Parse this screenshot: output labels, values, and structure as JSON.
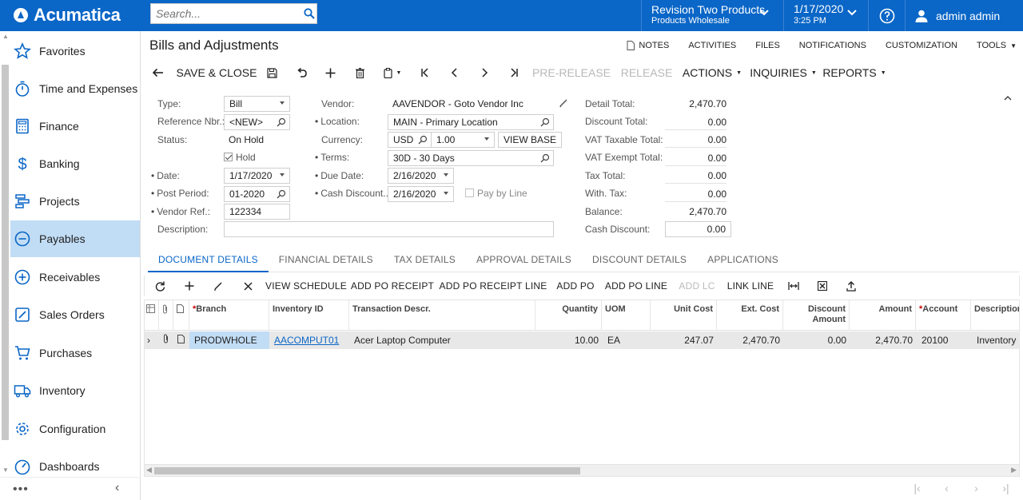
{
  "app": {
    "brand": "Acumatica"
  },
  "topbar": {
    "search_placeholder": "Search...",
    "company_line1": "Revision Two Products",
    "company_line2": "Products Wholesale",
    "date": "1/17/2020",
    "time": "3:25 PM",
    "user": "admin admin"
  },
  "sidebar": {
    "items": [
      {
        "label": "Favorites",
        "icon": "star-icon"
      },
      {
        "label": "Time and Expenses",
        "icon": "stopwatch-icon"
      },
      {
        "label": "Finance",
        "icon": "calculator-icon"
      },
      {
        "label": "Banking",
        "icon": "dollar-icon"
      },
      {
        "label": "Projects",
        "icon": "projects-icon"
      },
      {
        "label": "Payables",
        "icon": "minus-circle-icon",
        "active": true
      },
      {
        "label": "Receivables",
        "icon": "plus-circle-icon"
      },
      {
        "label": "Sales Orders",
        "icon": "edit-square-icon"
      },
      {
        "label": "Purchases",
        "icon": "cart-icon"
      },
      {
        "label": "Inventory",
        "icon": "truck-icon"
      },
      {
        "label": "Configuration",
        "icon": "gear-icon"
      },
      {
        "label": "Dashboards",
        "icon": "gauge-icon"
      }
    ],
    "more": "•••",
    "collapse": "‹"
  },
  "page": {
    "title": "Bills and Adjustments",
    "links": {
      "notes": "NOTES",
      "activities": "ACTIVITIES",
      "files": "FILES",
      "notifications": "NOTIFICATIONS",
      "customization": "CUSTOMIZATION",
      "tools": "TOOLS"
    }
  },
  "toolbar": {
    "save_close": "SAVE & CLOSE",
    "pre_release": "PRE-RELEASE",
    "release": "RELEASE",
    "actions": "ACTIONS",
    "inquiries": "INQUIRIES",
    "reports": "REPORTS"
  },
  "form": {
    "type": {
      "label": "Type:",
      "value": "Bill"
    },
    "ref_nbr": {
      "label": "Reference Nbr.:",
      "value": "<NEW>"
    },
    "status": {
      "label": "Status:",
      "value": "On Hold"
    },
    "hold": {
      "label": "Hold",
      "checked": true
    },
    "date": {
      "label": "Date:",
      "value": "1/17/2020"
    },
    "post_period": {
      "label": "Post Period:",
      "value": "01-2020"
    },
    "vendor_ref": {
      "label": "Vendor Ref.:",
      "value": "122334"
    },
    "description": {
      "label": "Description:",
      "value": ""
    },
    "vendor": {
      "label": "Vendor:",
      "value": "AAVENDOR - Goto Vendor Inc"
    },
    "location": {
      "label": "Location:",
      "value": "MAIN - Primary Location"
    },
    "currency": {
      "label": "Currency:",
      "code": "USD",
      "rate": "1.00",
      "view_base": "VIEW BASE"
    },
    "terms": {
      "label": "Terms:",
      "value": "30D - 30 Days"
    },
    "due_date": {
      "label": "Due Date:",
      "value": "2/16/2020"
    },
    "cash_discount_date": {
      "label": "Cash Discount...",
      "value": "2/16/2020"
    },
    "pay_by_line": {
      "label": "Pay by Line",
      "checked": false
    },
    "totals": [
      {
        "label": "Detail Total:",
        "value": "2,470.70"
      },
      {
        "label": "Discount Total:",
        "value": "0.00"
      },
      {
        "label": "VAT Taxable Total:",
        "value": "0.00"
      },
      {
        "label": "VAT Exempt Total:",
        "value": "0.00"
      },
      {
        "label": "Tax Total:",
        "value": "0.00"
      },
      {
        "label": "With. Tax:",
        "value": "0.00"
      },
      {
        "label": "Balance:",
        "value": "2,470.70"
      },
      {
        "label": "Cash Discount:",
        "value": "0.00"
      }
    ]
  },
  "tabs": [
    "DOCUMENT DETAILS",
    "FINANCIAL DETAILS",
    "TAX DETAILS",
    "APPROVAL DETAILS",
    "DISCOUNT DETAILS",
    "APPLICATIONS"
  ],
  "grid_toolbar": {
    "view_schedule": "VIEW SCHEDULE",
    "add_po_receipt": "ADD PO RECEIPT",
    "add_po_receipt_line": "ADD PO RECEIPT LINE",
    "add_po": "ADD PO",
    "add_po_line": "ADD PO LINE",
    "add_lc": "ADD LC",
    "link_line": "LINK LINE"
  },
  "grid": {
    "columns": {
      "branch": "Branch",
      "inventory_id": "Inventory ID",
      "transaction_descr": "Transaction Descr.",
      "quantity": "Quantity",
      "uom": "UOM",
      "unit_cost": "Unit Cost",
      "ext_cost": "Ext. Cost",
      "discount_amount_1": "Discount",
      "discount_amount_2": "Amount",
      "amount": "Amount",
      "account": "Account",
      "description": "Description"
    },
    "rows": [
      {
        "branch": "PRODWHOLE",
        "inventory_id": "AACOMPUT01",
        "transaction_descr": "Acer Laptop Computer",
        "quantity": "10.00",
        "uom": "EA",
        "unit_cost": "247.07",
        "ext_cost": "2,470.70",
        "discount_amount": "0.00",
        "amount": "2,470.70",
        "account": "20100",
        "description": "Inventory P"
      }
    ]
  },
  "colors": {
    "brand_blue": "#0a66c7",
    "active_nav": "#c1dcf5"
  }
}
